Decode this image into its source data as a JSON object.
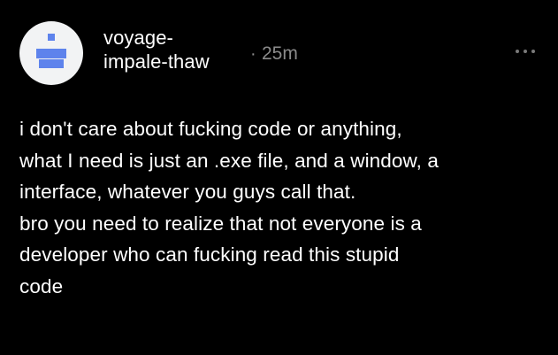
{
  "post": {
    "author": {
      "username": "voyage-\nimpale-thaw",
      "avatar": {
        "icon": "pixel-identicon-avatar",
        "background_color": "#f2f3f4",
        "pixel_color": "#5e83ec"
      }
    },
    "separator": "·",
    "timestamp": "25m",
    "more_icon": "ellipsis-icon",
    "body_lines": [
      "i don't care about fucking code or anything,",
      "what I need is just an .exe file, and a window, a",
      "interface, whatever you guys call that.",
      "bro you need to realize that not everyone is a",
      "developer who can fucking read this stupid",
      "code"
    ]
  },
  "colors": {
    "background": "#000000",
    "text": "#ffffff",
    "muted": "#8b8b8b"
  }
}
